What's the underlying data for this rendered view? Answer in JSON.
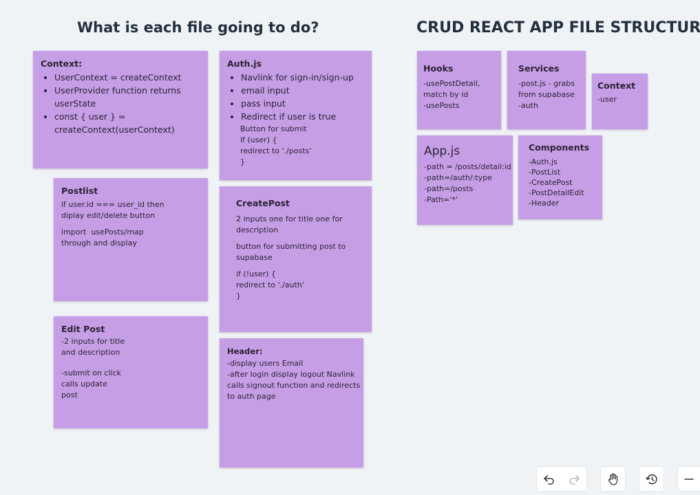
{
  "headings": {
    "left": "What is each file going to do?",
    "right": "CRUD REACT APP FILE STRUCTURE"
  },
  "notes": {
    "context_desc": {
      "title": "Context:",
      "bullets": [
        "UserContext = createContext",
        "UserProvider function returns userState",
        "const { user } = createContext(userContext)"
      ]
    },
    "auth_js": {
      "title": "Auth.js",
      "bullets": [
        "Navlink for sign-in/sign-up",
        "email input",
        "pass input",
        "Redirect if user is true"
      ],
      "lines": [
        "Button for submit",
        "if (user) {",
        "redirect to './posts'",
        "}"
      ]
    },
    "postlist": {
      "title": "Postlist",
      "p1": [
        "if user.id === user_id then",
        "diplay edit/delete button"
      ],
      "p2": [
        "import  usePosts/map",
        "through and display"
      ]
    },
    "createpost": {
      "title": "CreatePost",
      "p1": [
        "2 inputs one for title one for",
        "description"
      ],
      "p2": [
        "button for submitting post to",
        "supabase"
      ],
      "p3": [
        "if (!user) {",
        "redirect to './auth'",
        "}"
      ]
    },
    "editpost": {
      "title": "Edit Post",
      "p1": [
        "-2 inputs for title",
        "and description"
      ],
      "p2": [
        "-submit on click",
        "calls update",
        "post"
      ]
    },
    "header": {
      "title": "Header:",
      "lines": [
        "-display users Email",
        "-after login display logout Navlink",
        "calls signout function and redirects",
        "to auth page"
      ]
    },
    "hooks": {
      "title": "Hooks",
      "lines": [
        "-usePostDetail,",
        "match by id",
        "-usePosts"
      ]
    },
    "services": {
      "title": "Services",
      "lines": [
        "-post.js - grabs",
        "from supabase",
        "-auth"
      ]
    },
    "context_struct": {
      "title": "Context",
      "lines": [
        "-user"
      ]
    },
    "app_js": {
      "title": "App.js",
      "lines": [
        "-path = /posts/detail:id",
        "-path=/auth/:type",
        "-path=/posts",
        "-Path='*'"
      ]
    },
    "components": {
      "title": "Components",
      "lines": [
        "-Auth.js",
        "-PostList",
        "-CreatePost",
        "-PostDetailEdit",
        "-Header"
      ]
    }
  },
  "toolbar": {
    "undo": "undo-icon",
    "redo": "redo-icon",
    "hand": "hand-icon",
    "history": "history-icon",
    "zoom_out": "minus-icon"
  },
  "colors": {
    "sticky_note": "#c59ee6",
    "canvas": "#f0f3f6",
    "heading": "#23303e"
  }
}
